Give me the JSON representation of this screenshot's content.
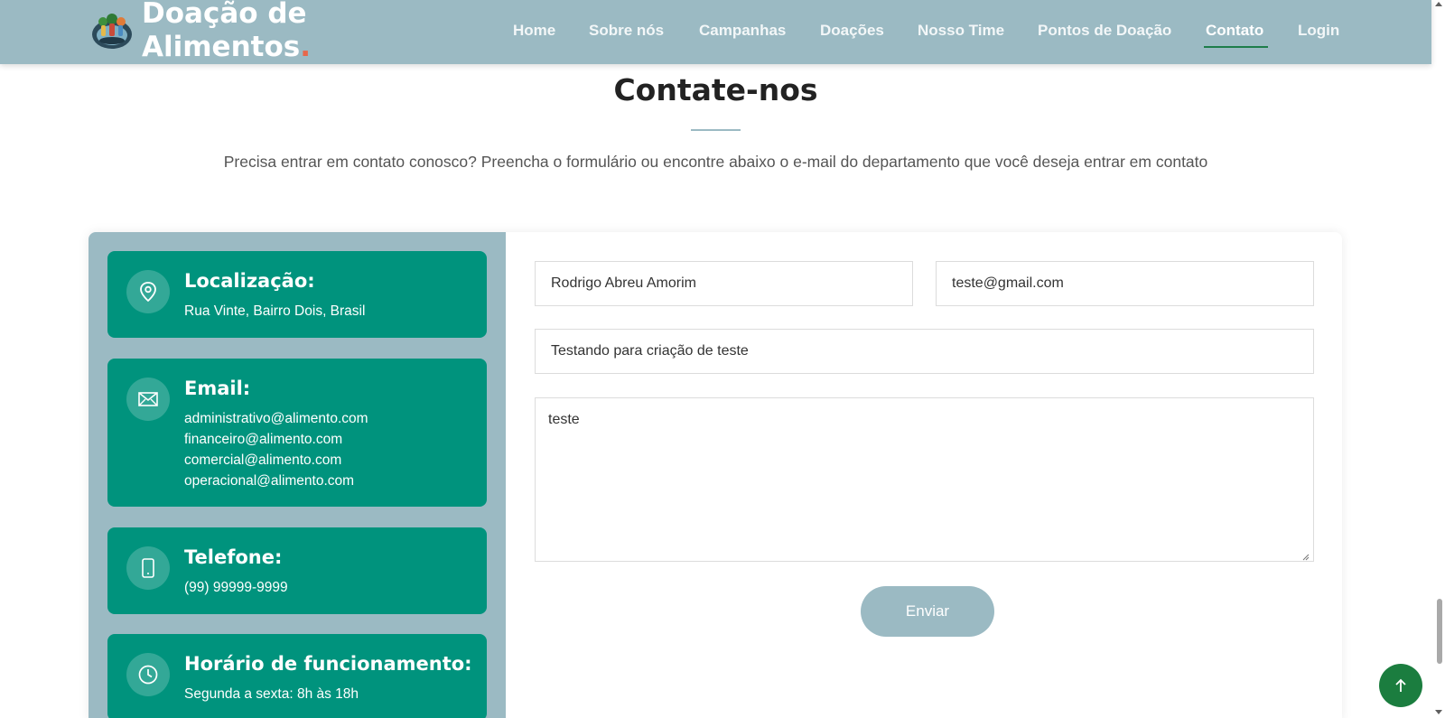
{
  "header": {
    "brand_line1": "Doação de",
    "brand_line2": "Alimentos",
    "brand_dot": ".",
    "logo_icon": "food-donation-logo-icon",
    "nav": [
      {
        "label": "Home",
        "active": false
      },
      {
        "label": "Sobre nós",
        "active": false
      },
      {
        "label": "Campanhas",
        "active": false
      },
      {
        "label": "Doações",
        "active": false
      },
      {
        "label": "Nosso Time",
        "active": false
      },
      {
        "label": "Pontos de Doação",
        "active": false
      },
      {
        "label": "Contato",
        "active": true
      },
      {
        "label": "Login",
        "active": false
      }
    ]
  },
  "contact": {
    "title": "Contate-nos",
    "subtitle": "Precisa entrar em contato conosco? Preencha o formulário ou encontre abaixo o e-mail do departamento que você deseja entrar em contato"
  },
  "info": {
    "location": {
      "title": "Localização:",
      "text": "Rua Vinte, Bairro Dois, Brasil",
      "icon": "map-pin-icon"
    },
    "email": {
      "title": "Email:",
      "icon": "envelope-icon",
      "lines": [
        "administrativo@alimento.com",
        "financeiro@alimento.com",
        "comercial@alimento.com",
        "operacional@alimento.com"
      ]
    },
    "phone": {
      "title": "Telefone:",
      "text": "(99) 99999-9999",
      "icon": "smartphone-icon"
    },
    "hours": {
      "title": "Horário de funcionamento:",
      "text": "Segunda a sexta: 8h às 18h",
      "icon": "clock-icon"
    }
  },
  "form": {
    "name_value": "Rodrigo Abreu Amorim",
    "email_value": "teste@gmail.com",
    "subject_value": "Testando para criação de teste",
    "message_value": "teste",
    "send_label": "Enviar"
  },
  "colors": {
    "header_bg": "#9bbac3",
    "card_bg": "#00937d",
    "active_underline": "#1e7d4a",
    "brand_dot": "#e8674a",
    "back_to_top": "#1b7d3f"
  },
  "back_to_top_icon": "arrow-up-icon"
}
